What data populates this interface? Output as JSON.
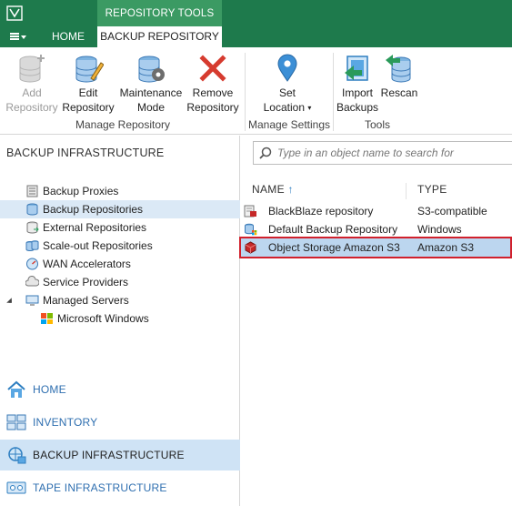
{
  "titlebar": {
    "context_tab": "REPOSITORY TOOLS"
  },
  "tabs": {
    "home": "HOME",
    "backup_repository": "BACKUP REPOSITORY"
  },
  "ribbon": {
    "buttons": {
      "add": [
        "Add",
        "Repository"
      ],
      "edit": [
        "Edit",
        "Repository"
      ],
      "maintenance": [
        "Maintenance",
        "Mode"
      ],
      "remove": [
        "Remove",
        "Repository"
      ],
      "set_location": [
        "Set",
        "Location"
      ],
      "import": [
        "Import",
        "Backups"
      ],
      "rescan": [
        "Rescan",
        ""
      ]
    },
    "groups": {
      "manage_repository": "Manage Repository",
      "manage_settings": "Manage Settings",
      "tools": "Tools"
    }
  },
  "left_panel": {
    "title": "BACKUP INFRASTRUCTURE",
    "tree": [
      {
        "label": "Backup Proxies"
      },
      {
        "label": "Backup Repositories"
      },
      {
        "label": "External Repositories"
      },
      {
        "label": "Scale-out Repositories"
      },
      {
        "label": "WAN Accelerators"
      },
      {
        "label": "Service Providers"
      },
      {
        "label": "Managed Servers"
      },
      {
        "label": "Microsoft Windows"
      }
    ],
    "nav": [
      {
        "label": "HOME"
      },
      {
        "label": "INVENTORY"
      },
      {
        "label": "BACKUP INFRASTRUCTURE"
      },
      {
        "label": "TAPE INFRASTRUCTURE"
      }
    ]
  },
  "search": {
    "placeholder": "Type in an object name to search for"
  },
  "table": {
    "columns": {
      "name": "NAME",
      "type": "TYPE"
    },
    "sort_indicator": "↑",
    "rows": [
      {
        "name": "BlackBlaze repository",
        "type": "S3-compatible"
      },
      {
        "name": "Default Backup Repository",
        "type": "Windows"
      },
      {
        "name": "Object Storage Amazon S3",
        "type": "Amazon S3"
      }
    ]
  },
  "colors": {
    "title_green": "#1e7a4c",
    "context_tab_green": "#3b9a63",
    "selection_blue": "#bcd6ef",
    "highlight_red": "#d1202c"
  }
}
